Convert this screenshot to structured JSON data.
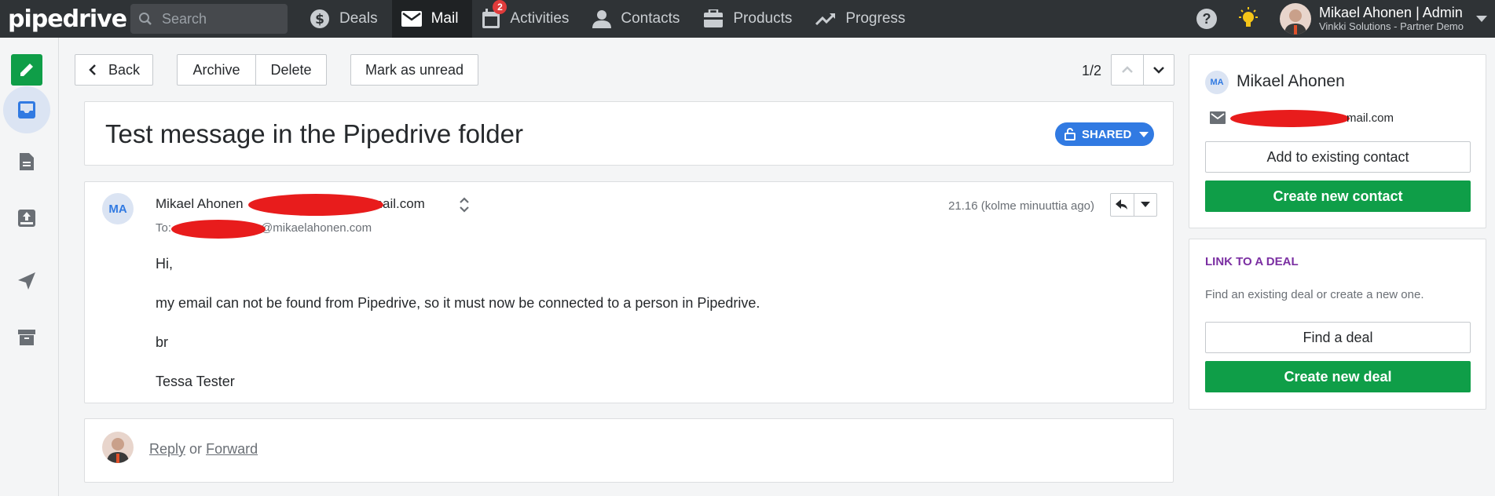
{
  "topbar": {
    "logo": "pipedrive",
    "search_placeholder": "Search",
    "nav": [
      {
        "label": "Deals",
        "icon": "dollar-icon"
      },
      {
        "label": "Mail",
        "icon": "mail-icon",
        "active": true
      },
      {
        "label": "Activities",
        "icon": "calendar-icon",
        "badge": "2"
      },
      {
        "label": "Contacts",
        "icon": "person-icon"
      },
      {
        "label": "Products",
        "icon": "box-icon"
      },
      {
        "label": "Progress",
        "icon": "trend-icon"
      }
    ],
    "user_name": "Mikael Ahonen | Admin",
    "user_company": "Vinkki Solutions - Partner Demo"
  },
  "sidebar": {
    "icons": [
      "compose-icon",
      "inbox-icon",
      "drafts-icon",
      "outbox-icon",
      "sent-icon",
      "archive-icon"
    ]
  },
  "toolbar": {
    "back_label": "Back",
    "archive_label": "Archive",
    "delete_label": "Delete",
    "mark_unread_label": "Mark as unread",
    "pager": "1/2"
  },
  "thread": {
    "subject": "Test message in the Pipedrive folder",
    "shared_label": "SHARED"
  },
  "message": {
    "avatar_initials": "MA",
    "from_name": "Mikael Ahonen",
    "from_email_suffix": "nail.com",
    "to_label": "To:",
    "to_email_suffix": "@mikaelahonen.com",
    "time": "21.16 (kolme minuuttia ago)",
    "body": [
      "Hi,",
      "my email can not be found from Pipedrive, so it must now be connected to a person in Pipedrive.",
      "br",
      "Tessa Tester"
    ]
  },
  "reply_bar": {
    "reply_label": "Reply",
    "or_label": "or",
    "forward_label": "Forward"
  },
  "contact_panel": {
    "initials": "MA",
    "name": "Mikael Ahonen",
    "email_suffix": "mail.com",
    "add_existing_label": "Add to existing contact",
    "create_new_label": "Create new contact"
  },
  "deal_panel": {
    "title": "LINK TO A DEAL",
    "description": "Find an existing deal or create a new one.",
    "find_label": "Find a deal",
    "create_label": "Create new deal"
  },
  "colors": {
    "topbar": "#2f3336",
    "accent_green": "#0f9e48",
    "accent_blue": "#317ae2",
    "deal_title": "#7b2fa2"
  }
}
